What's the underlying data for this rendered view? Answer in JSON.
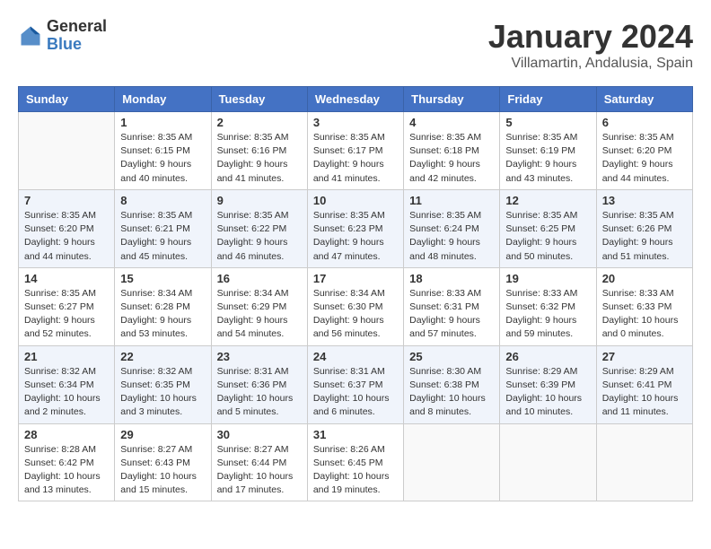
{
  "header": {
    "logo_general": "General",
    "logo_blue": "Blue",
    "title": "January 2024",
    "subtitle": "Villamartin, Andalusia, Spain"
  },
  "calendar": {
    "headers": [
      "Sunday",
      "Monday",
      "Tuesday",
      "Wednesday",
      "Thursday",
      "Friday",
      "Saturday"
    ],
    "weeks": [
      [
        {
          "day": "",
          "sunrise": "",
          "sunset": "",
          "daylight": ""
        },
        {
          "day": "1",
          "sunrise": "Sunrise: 8:35 AM",
          "sunset": "Sunset: 6:15 PM",
          "daylight": "Daylight: 9 hours and 40 minutes."
        },
        {
          "day": "2",
          "sunrise": "Sunrise: 8:35 AM",
          "sunset": "Sunset: 6:16 PM",
          "daylight": "Daylight: 9 hours and 41 minutes."
        },
        {
          "day": "3",
          "sunrise": "Sunrise: 8:35 AM",
          "sunset": "Sunset: 6:17 PM",
          "daylight": "Daylight: 9 hours and 41 minutes."
        },
        {
          "day": "4",
          "sunrise": "Sunrise: 8:35 AM",
          "sunset": "Sunset: 6:18 PM",
          "daylight": "Daylight: 9 hours and 42 minutes."
        },
        {
          "day": "5",
          "sunrise": "Sunrise: 8:35 AM",
          "sunset": "Sunset: 6:19 PM",
          "daylight": "Daylight: 9 hours and 43 minutes."
        },
        {
          "day": "6",
          "sunrise": "Sunrise: 8:35 AM",
          "sunset": "Sunset: 6:20 PM",
          "daylight": "Daylight: 9 hours and 44 minutes."
        }
      ],
      [
        {
          "day": "7",
          "sunrise": "Sunrise: 8:35 AM",
          "sunset": "Sunset: 6:20 PM",
          "daylight": "Daylight: 9 hours and 44 minutes."
        },
        {
          "day": "8",
          "sunrise": "Sunrise: 8:35 AM",
          "sunset": "Sunset: 6:21 PM",
          "daylight": "Daylight: 9 hours and 45 minutes."
        },
        {
          "day": "9",
          "sunrise": "Sunrise: 8:35 AM",
          "sunset": "Sunset: 6:22 PM",
          "daylight": "Daylight: 9 hours and 46 minutes."
        },
        {
          "day": "10",
          "sunrise": "Sunrise: 8:35 AM",
          "sunset": "Sunset: 6:23 PM",
          "daylight": "Daylight: 9 hours and 47 minutes."
        },
        {
          "day": "11",
          "sunrise": "Sunrise: 8:35 AM",
          "sunset": "Sunset: 6:24 PM",
          "daylight": "Daylight: 9 hours and 48 minutes."
        },
        {
          "day": "12",
          "sunrise": "Sunrise: 8:35 AM",
          "sunset": "Sunset: 6:25 PM",
          "daylight": "Daylight: 9 hours and 50 minutes."
        },
        {
          "day": "13",
          "sunrise": "Sunrise: 8:35 AM",
          "sunset": "Sunset: 6:26 PM",
          "daylight": "Daylight: 9 hours and 51 minutes."
        }
      ],
      [
        {
          "day": "14",
          "sunrise": "Sunrise: 8:35 AM",
          "sunset": "Sunset: 6:27 PM",
          "daylight": "Daylight: 9 hours and 52 minutes."
        },
        {
          "day": "15",
          "sunrise": "Sunrise: 8:34 AM",
          "sunset": "Sunset: 6:28 PM",
          "daylight": "Daylight: 9 hours and 53 minutes."
        },
        {
          "day": "16",
          "sunrise": "Sunrise: 8:34 AM",
          "sunset": "Sunset: 6:29 PM",
          "daylight": "Daylight: 9 hours and 54 minutes."
        },
        {
          "day": "17",
          "sunrise": "Sunrise: 8:34 AM",
          "sunset": "Sunset: 6:30 PM",
          "daylight": "Daylight: 9 hours and 56 minutes."
        },
        {
          "day": "18",
          "sunrise": "Sunrise: 8:33 AM",
          "sunset": "Sunset: 6:31 PM",
          "daylight": "Daylight: 9 hours and 57 minutes."
        },
        {
          "day": "19",
          "sunrise": "Sunrise: 8:33 AM",
          "sunset": "Sunset: 6:32 PM",
          "daylight": "Daylight: 9 hours and 59 minutes."
        },
        {
          "day": "20",
          "sunrise": "Sunrise: 8:33 AM",
          "sunset": "Sunset: 6:33 PM",
          "daylight": "Daylight: 10 hours and 0 minutes."
        }
      ],
      [
        {
          "day": "21",
          "sunrise": "Sunrise: 8:32 AM",
          "sunset": "Sunset: 6:34 PM",
          "daylight": "Daylight: 10 hours and 2 minutes."
        },
        {
          "day": "22",
          "sunrise": "Sunrise: 8:32 AM",
          "sunset": "Sunset: 6:35 PM",
          "daylight": "Daylight: 10 hours and 3 minutes."
        },
        {
          "day": "23",
          "sunrise": "Sunrise: 8:31 AM",
          "sunset": "Sunset: 6:36 PM",
          "daylight": "Daylight: 10 hours and 5 minutes."
        },
        {
          "day": "24",
          "sunrise": "Sunrise: 8:31 AM",
          "sunset": "Sunset: 6:37 PM",
          "daylight": "Daylight: 10 hours and 6 minutes."
        },
        {
          "day": "25",
          "sunrise": "Sunrise: 8:30 AM",
          "sunset": "Sunset: 6:38 PM",
          "daylight": "Daylight: 10 hours and 8 minutes."
        },
        {
          "day": "26",
          "sunrise": "Sunrise: 8:29 AM",
          "sunset": "Sunset: 6:39 PM",
          "daylight": "Daylight: 10 hours and 10 minutes."
        },
        {
          "day": "27",
          "sunrise": "Sunrise: 8:29 AM",
          "sunset": "Sunset: 6:41 PM",
          "daylight": "Daylight: 10 hours and 11 minutes."
        }
      ],
      [
        {
          "day": "28",
          "sunrise": "Sunrise: 8:28 AM",
          "sunset": "Sunset: 6:42 PM",
          "daylight": "Daylight: 10 hours and 13 minutes."
        },
        {
          "day": "29",
          "sunrise": "Sunrise: 8:27 AM",
          "sunset": "Sunset: 6:43 PM",
          "daylight": "Daylight: 10 hours and 15 minutes."
        },
        {
          "day": "30",
          "sunrise": "Sunrise: 8:27 AM",
          "sunset": "Sunset: 6:44 PM",
          "daylight": "Daylight: 10 hours and 17 minutes."
        },
        {
          "day": "31",
          "sunrise": "Sunrise: 8:26 AM",
          "sunset": "Sunset: 6:45 PM",
          "daylight": "Daylight: 10 hours and 19 minutes."
        },
        {
          "day": "",
          "sunrise": "",
          "sunset": "",
          "daylight": ""
        },
        {
          "day": "",
          "sunrise": "",
          "sunset": "",
          "daylight": ""
        },
        {
          "day": "",
          "sunrise": "",
          "sunset": "",
          "daylight": ""
        }
      ]
    ]
  }
}
